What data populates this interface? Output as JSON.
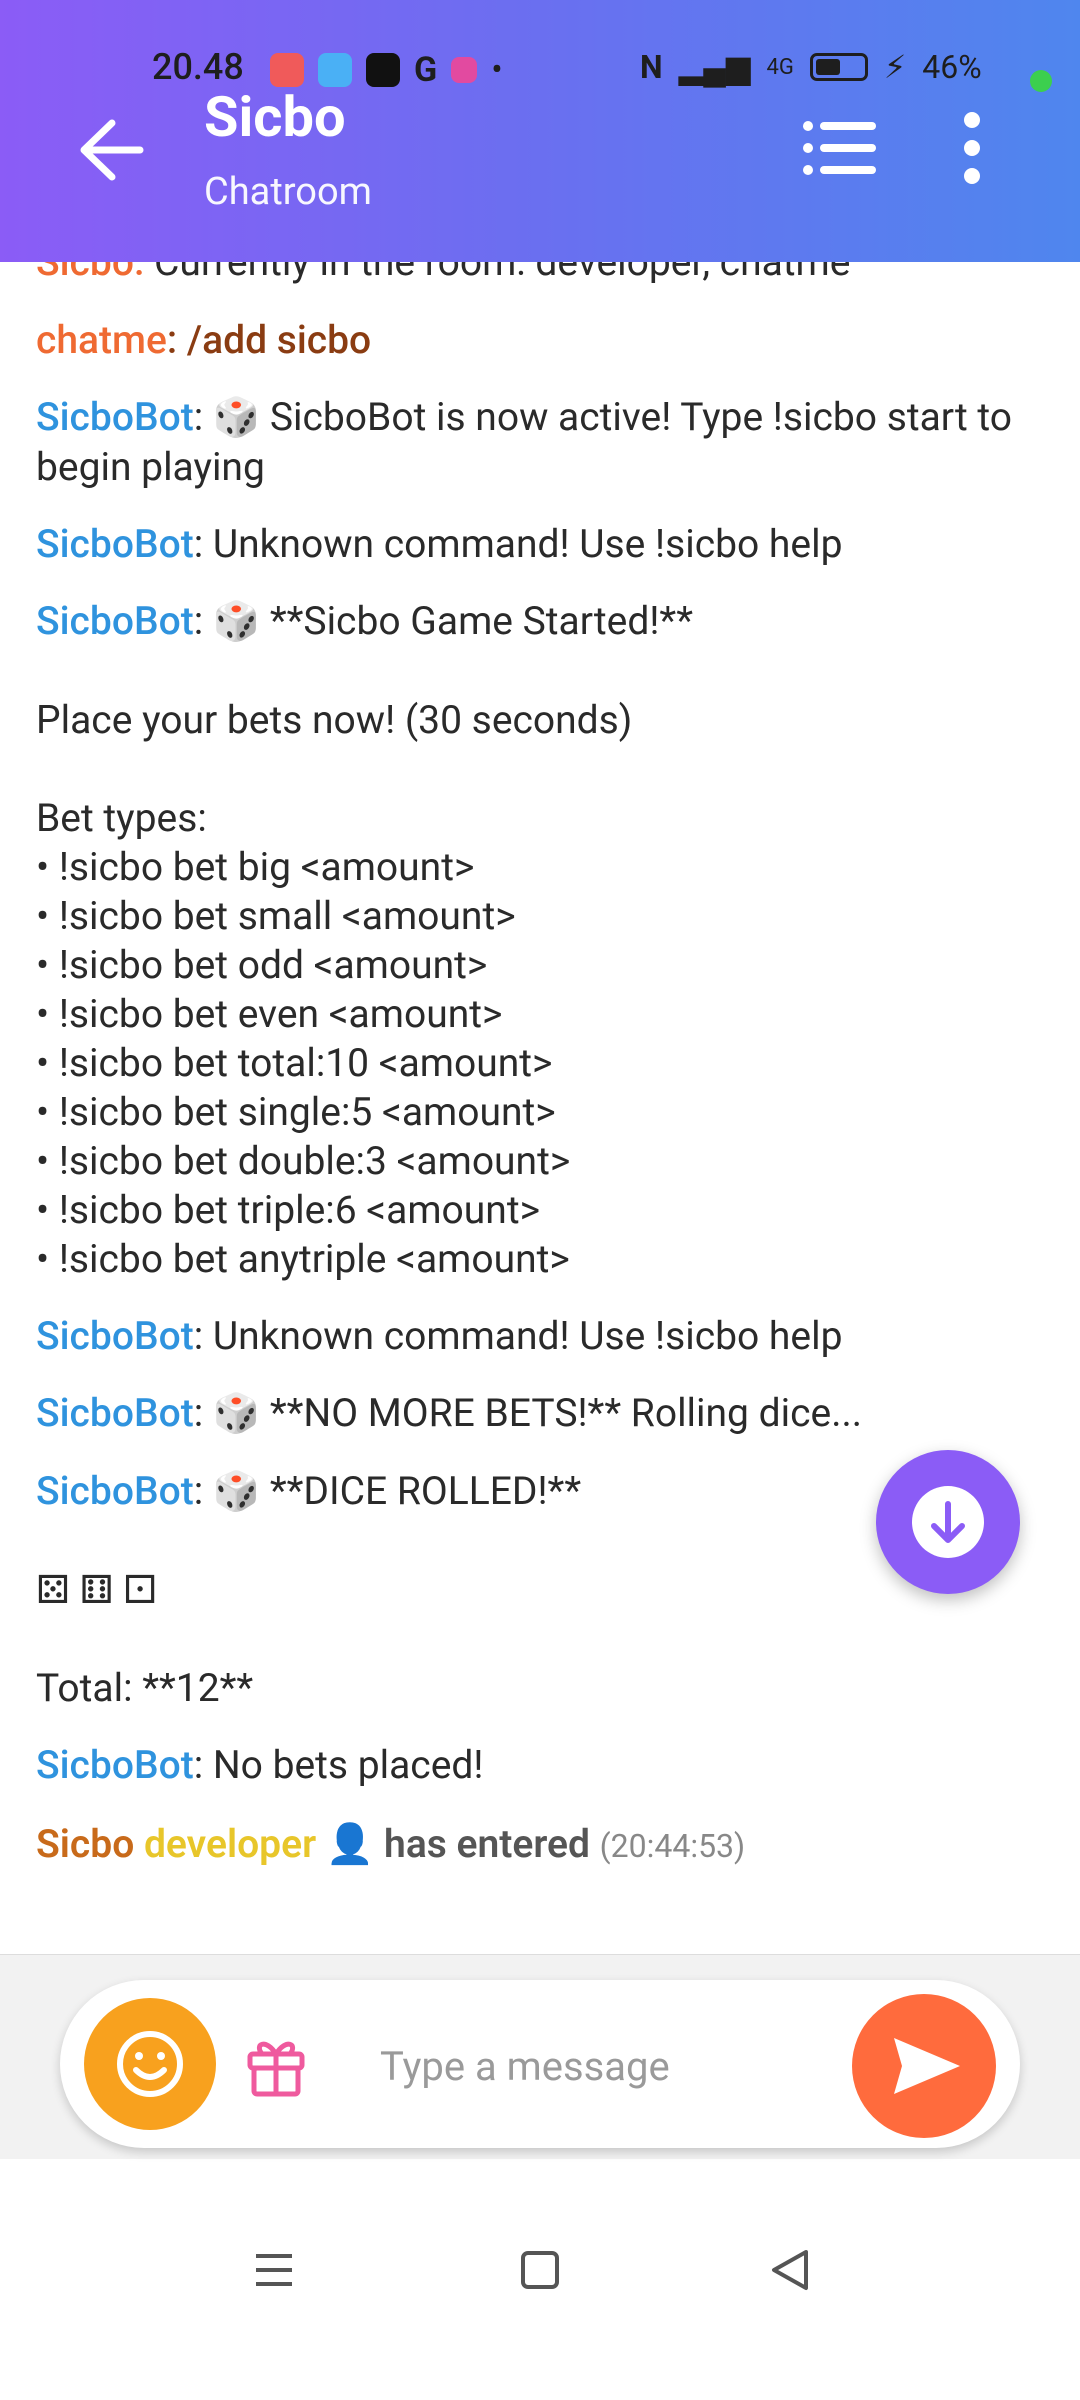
{
  "status_bar": {
    "time": "20.48",
    "battery_percent": "46%",
    "network": "4G"
  },
  "header": {
    "title": "Sicbo",
    "subtitle": "Chatroom"
  },
  "messages": [
    {
      "user": "Sicbo",
      "text": " Currently in the room: developer, chatme",
      "partial": true
    },
    {
      "user": "chatme",
      "text": "/add sicbo"
    },
    {
      "user": "SicboBot",
      "emoji": "🎲",
      "text": " SicboBot is now active! Type !sicbo start to begin playing"
    },
    {
      "user": "SicboBot",
      "text": "Unknown command! Use !sicbo help"
    },
    {
      "user": "SicboBot",
      "emoji": "🎲",
      "text": " **Sicbo Game Started!**\n\nPlace your bets now! (30 seconds)\n\nBet types:\n• !sicbo bet big <amount>\n• !sicbo bet small <amount>\n• !sicbo bet odd <amount>\n• !sicbo bet even <amount>\n• !sicbo bet total:10 <amount>\n• !sicbo bet single:5 <amount>\n• !sicbo bet double:3 <amount>\n• !sicbo bet triple:6 <amount>\n• !sicbo bet anytriple <amount>"
    },
    {
      "user": "SicboBot",
      "text": "Unknown command! Use !sicbo help"
    },
    {
      "user": "SicboBot",
      "emoji": "🎲",
      "text": " **NO MORE BETS!** Rolling dice..."
    },
    {
      "user": "SicboBot",
      "emoji": "🎲",
      "text": " **DICE ROLLED!**\n\n⚄ ⚅ ⚀\n\nTotal: **12**"
    },
    {
      "user": "SicboBot",
      "text": "No bets placed!"
    }
  ],
  "entered": {
    "room": "Sicbo",
    "user": "developer",
    "text": "has entered",
    "time": "(20:44:53)"
  },
  "composer": {
    "placeholder": "Type a message"
  },
  "colors": {
    "bot_name": "#2f93de",
    "chatme_name": "#ef6a32",
    "fab": "#8b5cf6",
    "send": "#ff6b3d",
    "emoji_button": "#f8a11e"
  },
  "icons": {
    "back": "arrow-left-icon",
    "list": "list-icon",
    "more": "more-vertical-icon",
    "scroll": "arrow-down-icon",
    "emoji": "smiley-icon",
    "gift": "gift-icon",
    "send": "send-icon"
  }
}
